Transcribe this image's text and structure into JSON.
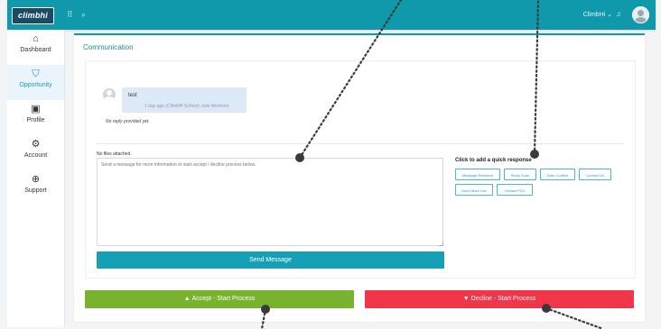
{
  "app": {
    "logo_text": "climbhi",
    "user_name": "ClimbHi ⌄"
  },
  "icons": {
    "menu": "grid-icon",
    "search": "search-icon",
    "bell": "bell-icon"
  },
  "sidebar": {
    "items": [
      {
        "label": "Dashboard",
        "icon": "dashboard-icon",
        "glyph": "⌂",
        "active": false
      },
      {
        "label": "Opportunity",
        "icon": "opportunity-icon",
        "glyph": "⛉",
        "active": true
      },
      {
        "label": "Profile",
        "icon": "profile-icon",
        "glyph": "▣",
        "active": false
      },
      {
        "label": "Account",
        "icon": "account-icon",
        "glyph": "⚙",
        "active": false
      },
      {
        "label": "Support",
        "icon": "support-icon",
        "glyph": "⊕",
        "active": false
      }
    ]
  },
  "communication": {
    "title": "Communication",
    "message": {
      "text": "test",
      "meta": "1 day ago (ClimbHi School) Julie Morrison"
    },
    "no_reply": "No reply provided yet.",
    "files_label": "No files attached.",
    "message_placeholder": "Send a message for more information or start accept / decline process below.",
    "send_label": "Send Message",
    "quick_title": "Click to add a quick response",
    "quick_responses": [
      "Message Received",
      "Reply Soon",
      "Date Conflict",
      "Contact Us",
      "Need More Info",
      "Contact POC"
    ]
  },
  "actions": {
    "accept_label": "Accept - Start Process",
    "decline_label": "Decline - Start Process"
  },
  "colors": {
    "header": "#0f99ab",
    "accept": "#78b22f",
    "decline": "#f2364a",
    "annotation": "#444444"
  }
}
